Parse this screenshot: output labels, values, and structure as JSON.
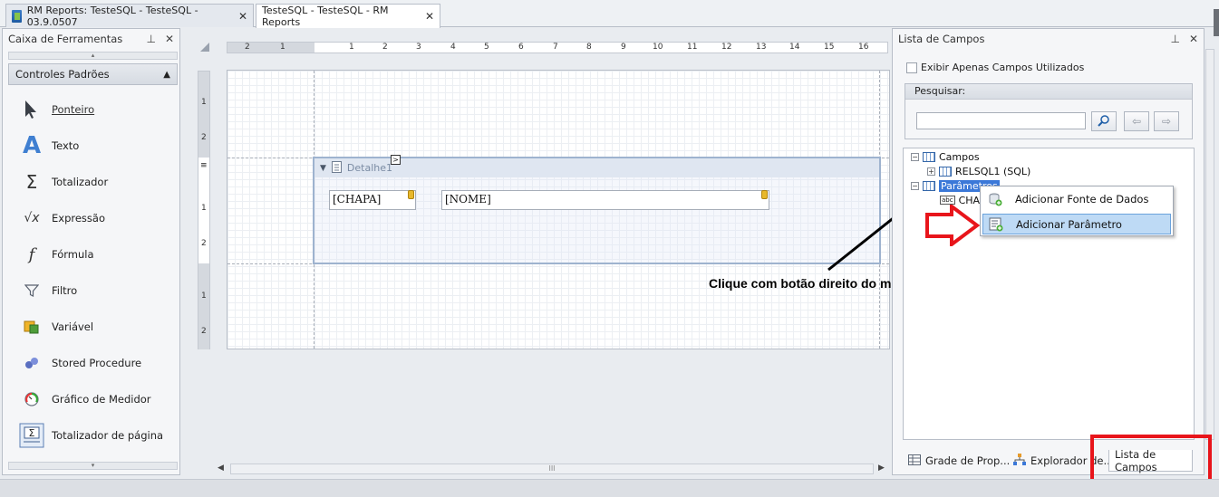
{
  "doc_tabs": [
    {
      "label": "RM Reports: TesteSQL - TesteSQL - 03.9.0507"
    },
    {
      "label": "TesteSQL - TesteSQL - RM Reports"
    }
  ],
  "toolbox": {
    "title": "Caixa de Ferramentas",
    "group": "Controles Padrões",
    "items": [
      {
        "label": "Ponteiro",
        "icon": "pointer-icon"
      },
      {
        "label": "Texto",
        "icon": "text-icon"
      },
      {
        "label": "Totalizador",
        "icon": "sigma-icon"
      },
      {
        "label": "Expressão",
        "icon": "sqrt-icon"
      },
      {
        "label": "Fórmula",
        "icon": "function-icon"
      },
      {
        "label": "Filtro",
        "icon": "filter-icon"
      },
      {
        "label": "Variável",
        "icon": "variable-icon"
      },
      {
        "label": "Stored Procedure",
        "icon": "stored-procedure-icon"
      },
      {
        "label": "Gráfico de Medidor",
        "icon": "gauge-icon"
      },
      {
        "label": "Totalizador de página",
        "icon": "page-total-icon"
      }
    ]
  },
  "designer": {
    "ruler_h": [
      "2",
      "1",
      "1",
      "2",
      "3",
      "4",
      "5",
      "6",
      "7",
      "8",
      "9",
      "10",
      "11",
      "12",
      "13",
      "14",
      "15",
      "16"
    ],
    "ruler_v_top": [
      "1",
      "2"
    ],
    "ruler_v_mid": [
      "1",
      "2"
    ],
    "ruler_v_bot": [
      "1",
      "2"
    ],
    "band": {
      "label": "Detalhe1"
    },
    "fields": [
      {
        "text": "[CHAPA]"
      },
      {
        "text": "[NOME]"
      }
    ],
    "smart_tag": ">",
    "scroll_grip": "III"
  },
  "field_list": {
    "title": "Lista de Campos",
    "checkbox_label": "Exibir Apenas Campos Utilizados",
    "search_label": "Pesquisar:",
    "search_value": "",
    "tree": {
      "campos": "Campos",
      "relsql": "RELSQL1 (SQL)",
      "parametros": "Parâmetros",
      "chapa_partial": "CHAP"
    },
    "context_menu": [
      {
        "label": "Adicionar Fonte de Dados"
      },
      {
        "label": "Adicionar Parâmetro"
      }
    ]
  },
  "bottom_tabs": [
    {
      "label": "Grade de Prop..."
    },
    {
      "label": "Explorador de..."
    },
    {
      "label": "Lista de Campos"
    }
  ],
  "annotation": "Clique com botão direito do mouse",
  "colors": {
    "highlight": "#e8151b",
    "selection": "#3b78d8",
    "menu_hover": "#bedaf5"
  }
}
